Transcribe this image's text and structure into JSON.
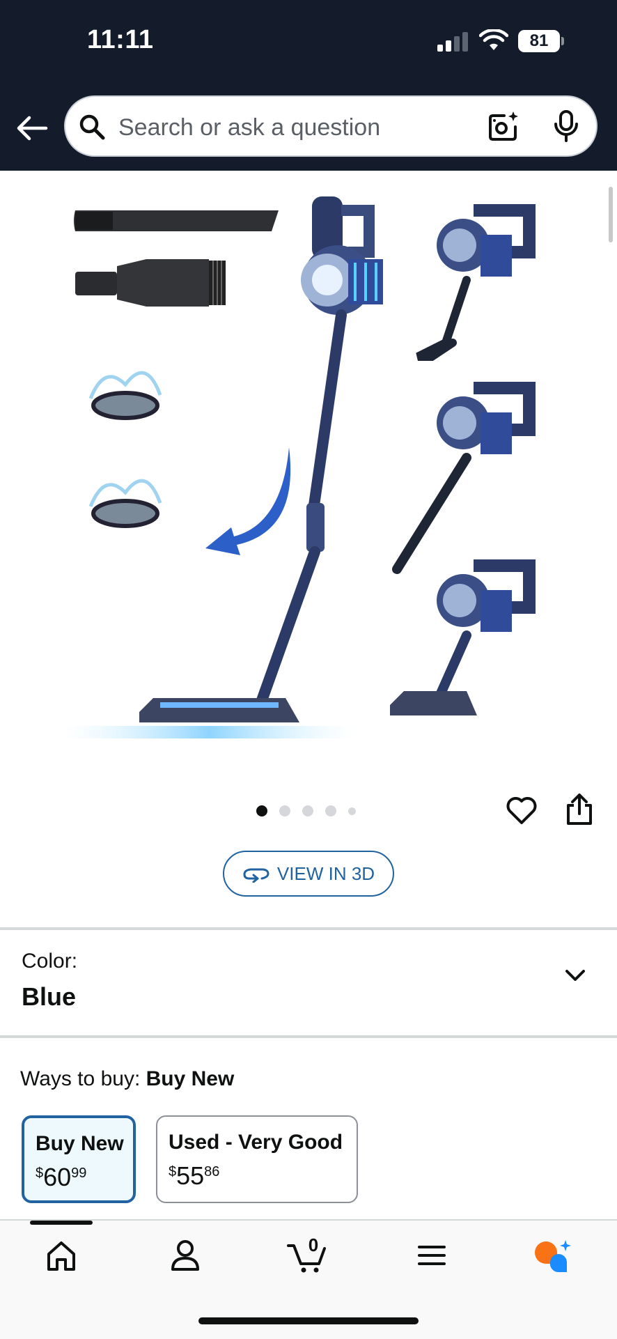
{
  "status_bar": {
    "time": "11:11",
    "battery": "81"
  },
  "search": {
    "placeholder": "Search or ask a question"
  },
  "gallery": {
    "dot_count": 5,
    "active_index": 0
  },
  "view_3d": {
    "label": "VIEW IN 3D"
  },
  "color": {
    "label": "Color:",
    "value": "Blue"
  },
  "ways_to_buy": {
    "label": "Ways to buy:",
    "selected": "Buy New",
    "options": [
      {
        "title": "Buy New",
        "currency": "$",
        "whole": "60",
        "fraction": "99",
        "selected": true
      },
      {
        "title": "Used - Very Good",
        "currency": "$",
        "whole": "55",
        "fraction": "86",
        "selected": false
      }
    ]
  },
  "tab_bar": {
    "cart_count": "0",
    "active_tab": "home"
  },
  "colors": {
    "header_bg": "#141c2b",
    "accent_blue": "#2162a1",
    "selected_bg": "#edf9fd",
    "divider": "#d5d9d9"
  }
}
